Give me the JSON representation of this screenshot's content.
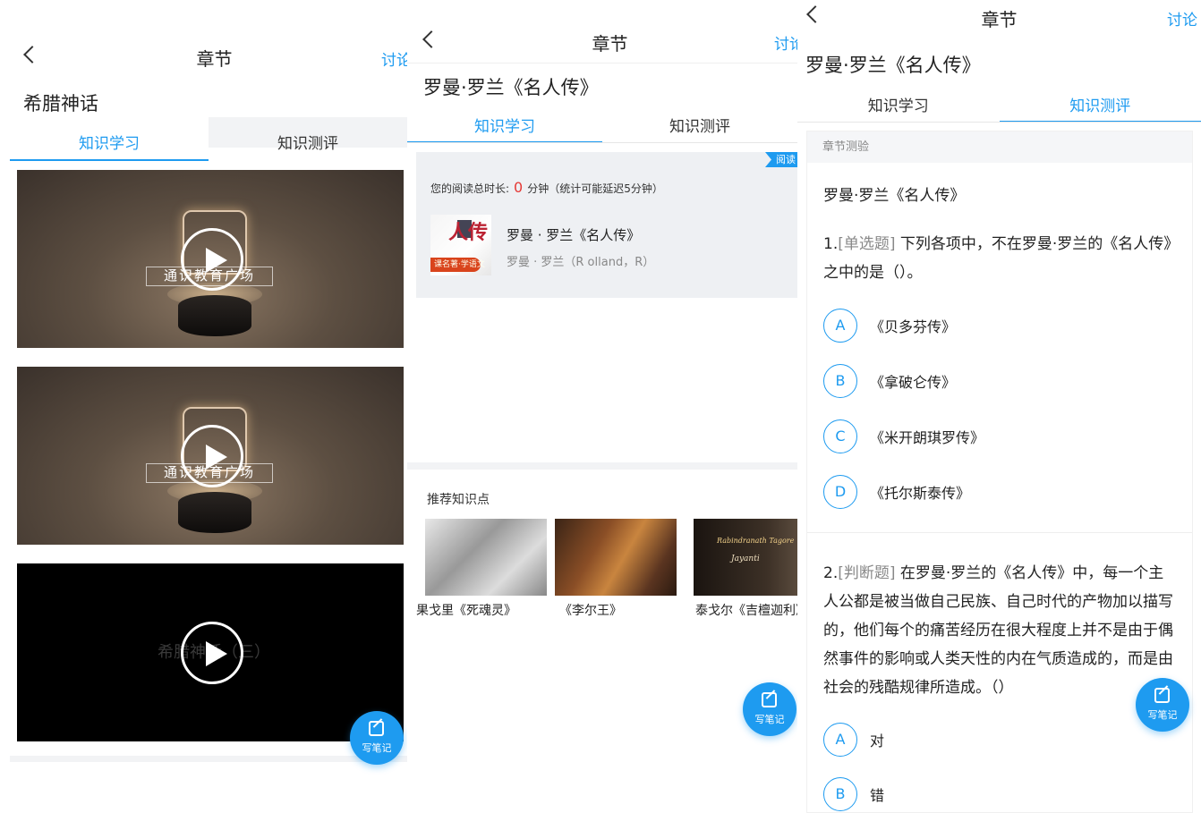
{
  "colors": {
    "accent": "#1e9bf0",
    "highlight": "#e53935"
  },
  "panel1": {
    "header": {
      "title": "章节",
      "discuss": "讨论"
    },
    "chapter_title": "希腊神话",
    "tabs": [
      "知识学习",
      "知识测评"
    ],
    "videos": [
      {
        "banner": "通识教育广场",
        "style": "stage"
      },
      {
        "banner": "通识教育广场",
        "style": "stage"
      },
      {
        "banner": "希腊神话（三）",
        "style": "dark"
      }
    ],
    "fab_label": "写笔记"
  },
  "panel2": {
    "header": {
      "title": "章节",
      "discuss": "讨论"
    },
    "chapter_title": "罗曼·罗兰《名人传》",
    "tabs": [
      "知识学习",
      "知识测评"
    ],
    "read_flag": "阅读",
    "read_prefix": "您的阅读总时长:",
    "read_minutes": "0",
    "read_suffix": "分钟（统计可能延迟5分钟）",
    "book": {
      "cover_char": "人传",
      "cover_strip": "课名著·学语文",
      "title": "罗曼 · 罗兰《名人传》",
      "author": "罗曼 · 罗兰（R olland，R）"
    },
    "recommend_title": "推荐知识点",
    "recommend": [
      {
        "caption": "果戈里《死魂灵》"
      },
      {
        "caption": "《李尔王》"
      },
      {
        "caption": "泰戈尔《吉檀迦利》",
        "thumb_text1": "Rabindranath Tagore",
        "thumb_text2": "Jayanti"
      }
    ],
    "fab_label": "写笔记"
  },
  "panel3": {
    "header": {
      "title": "章节",
      "discuss": "讨论"
    },
    "chapter_title": "罗曼·罗兰《名人传》",
    "tabs": [
      "知识学习",
      "知识测评"
    ],
    "quiz_header": "章节测验",
    "quiz_name": "罗曼·罗兰《名人传》",
    "q1": {
      "num": "1.",
      "type": "[单选题]",
      "text": "下列各项中，不在罗曼·罗兰的《名人传》之中的是（）。",
      "options": [
        {
          "letter": "A",
          "text": "《贝多芬传》"
        },
        {
          "letter": "B",
          "text": "《拿破仑传》"
        },
        {
          "letter": "C",
          "text": "《米开朗琪罗传》"
        },
        {
          "letter": "D",
          "text": "《托尔斯泰传》"
        }
      ]
    },
    "q2": {
      "num": "2.",
      "type": "[判断题]",
      "text": "在罗曼·罗兰的《名人传》中，每一个主人公都是被当做自己民族、自己时代的产物加以描写的，他们每个的痛苦经历在很大程度上并不是由于偶然事件的影响或人类天性的内在气质造成的，而是由社会的残酷规律所造成。（）",
      "options": [
        {
          "letter": "A",
          "text": "对"
        },
        {
          "letter": "B",
          "text": "错"
        }
      ]
    },
    "fab_label": "写笔记"
  }
}
